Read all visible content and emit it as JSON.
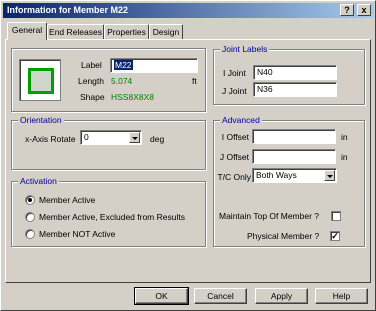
{
  "window": {
    "title": "Information for Member M22",
    "help_btn": "?",
    "close_btn": "x"
  },
  "tabs": [
    "General",
    "End Releases",
    "Properties",
    "Design"
  ],
  "member": {
    "label_caption": "Label",
    "label_value": "M22",
    "length_caption": "Length",
    "length_value": "5.074",
    "length_unit": "ft",
    "shape_caption": "Shape",
    "shape_value": "HSS8X8X8"
  },
  "joint_labels": {
    "title": "Joint Labels",
    "i_caption": "I Joint",
    "i_value": "N40",
    "j_caption": "J Joint",
    "j_value": "N36"
  },
  "orientation": {
    "title": "Orientation",
    "rotate_caption": "x-Axis Rotate",
    "rotate_value": "0",
    "unit": "deg"
  },
  "advanced": {
    "title": "Advanced",
    "i_offset_caption": "I Offset",
    "i_offset_value": "",
    "i_offset_unit": "in",
    "j_offset_caption": "J Offset",
    "j_offset_value": "",
    "j_offset_unit": "in",
    "tc_caption": "T/C Only",
    "tc_value": "Both Ways",
    "maintain_top_caption": "Maintain Top Of Member ?",
    "maintain_top_checked": false,
    "physical_caption": "Physical Member ?",
    "physical_checked": true
  },
  "activation": {
    "title": "Activation",
    "options": [
      "Member Active",
      "Member Active, Excluded from Results",
      "Member NOT Active"
    ],
    "selected_index": 0
  },
  "buttons": {
    "ok": "OK",
    "cancel": "Cancel",
    "apply": "Apply",
    "help": "Help"
  },
  "check_mark": "✓"
}
